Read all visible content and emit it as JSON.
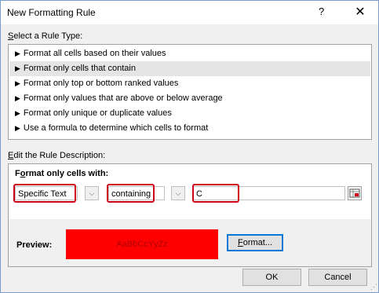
{
  "window": {
    "title": "New Formatting Rule",
    "help_label": "?",
    "close_label": "✕"
  },
  "rule_type": {
    "label_prefix": "",
    "label_access": "S",
    "label_rest": "elect a Rule Type:",
    "items": [
      {
        "label": "Format all cells based on their values"
      },
      {
        "label": "Format only cells that contain"
      },
      {
        "label": "Format only top or bottom ranked values"
      },
      {
        "label": "Format only values that are above or below average"
      },
      {
        "label": "Format only unique or duplicate values"
      },
      {
        "label": "Use a formula to determine which cells to format"
      }
    ],
    "selected_index": 1,
    "bullet": "▶"
  },
  "description": {
    "label_access": "E",
    "label_rest": "dit the Rule Description:",
    "format_label_pre": "F",
    "format_label_access": "o",
    "format_label_rest": "rmat only cells with:",
    "condition_type": "Specific Text",
    "operator": "containing",
    "value": "C",
    "dropdown_glyph": "⌵"
  },
  "preview": {
    "label": "Preview:",
    "sample_text": "AaBbCcYyZz",
    "fill_color": "#ff0000",
    "format_button_access": "F",
    "format_button_rest": "ormat..."
  },
  "buttons": {
    "ok": "OK",
    "cancel": "Cancel"
  },
  "highlight_color": "#d0021b"
}
